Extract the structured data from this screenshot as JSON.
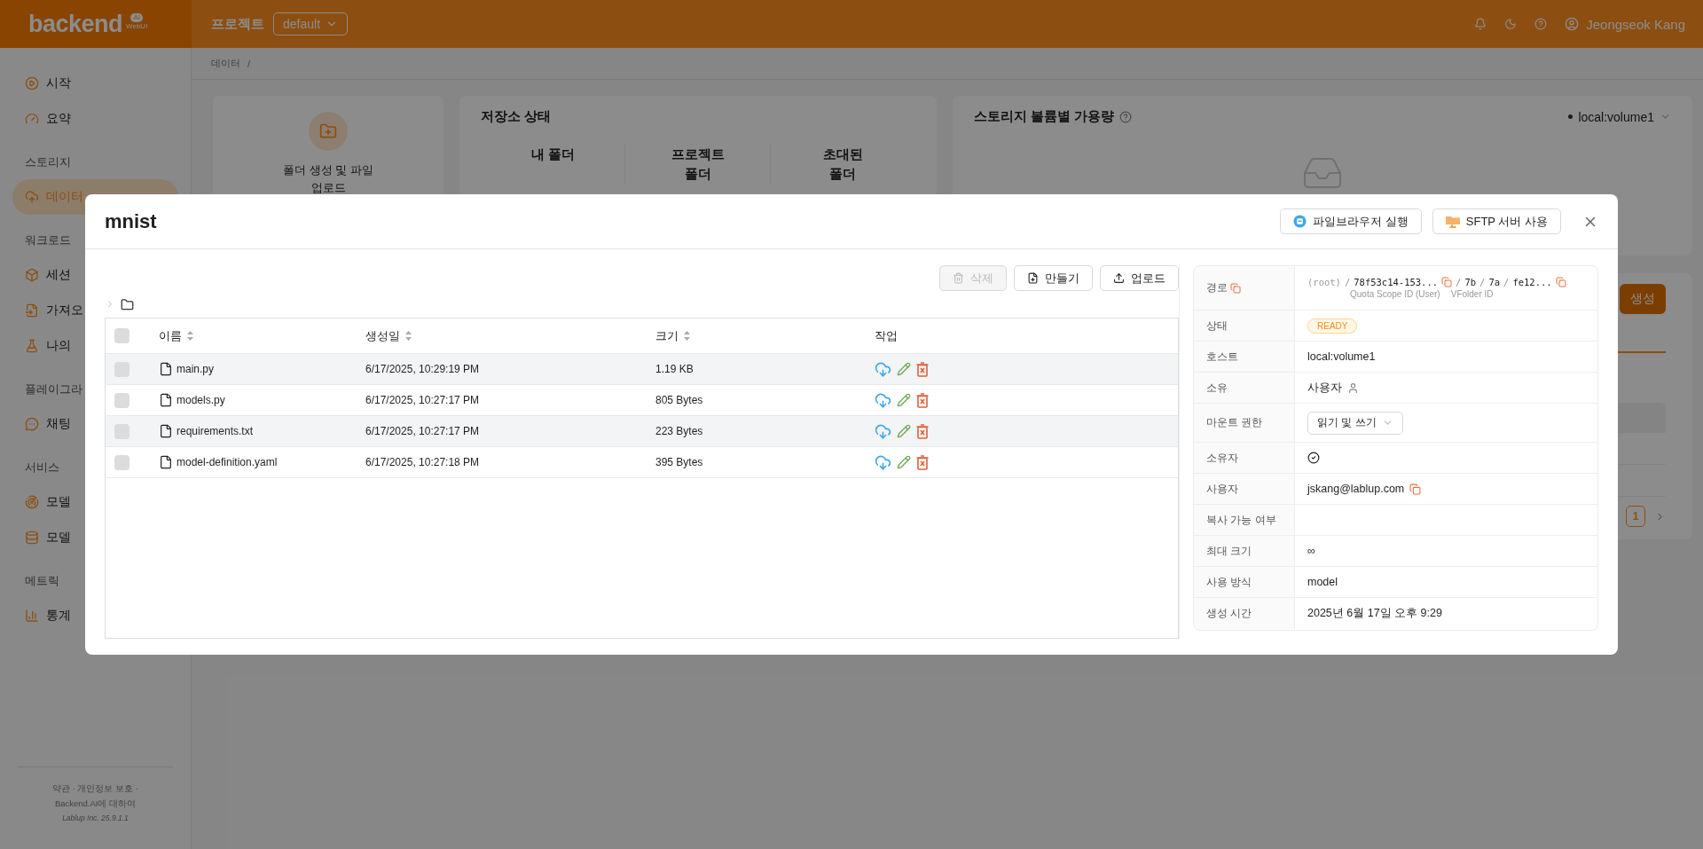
{
  "header": {
    "logo": {
      "word": "backend",
      "badge": "AI",
      "sub": "WebUI"
    },
    "project_label": "프로젝트",
    "project": "default",
    "user": "Jeongseok Kang"
  },
  "breadcrumb": {
    "current": "데이터",
    "separator": "/"
  },
  "sidebar": {
    "items": [
      {
        "kind": "item",
        "label": "시작",
        "selected": false
      },
      {
        "kind": "item",
        "label": "요약",
        "selected": false
      },
      {
        "kind": "section",
        "label": "스토리지"
      },
      {
        "kind": "item",
        "label": "데이터",
        "selected": true
      },
      {
        "kind": "section",
        "label": "워크로드"
      },
      {
        "kind": "item",
        "label": "세션",
        "selected": false
      },
      {
        "kind": "item",
        "label": "가져오",
        "selected": false
      },
      {
        "kind": "item",
        "label": "나의",
        "selected": false
      },
      {
        "kind": "section",
        "label": "플레이그라"
      },
      {
        "kind": "item",
        "label": "채팅",
        "selected": false
      },
      {
        "kind": "section",
        "label": "서비스"
      },
      {
        "kind": "item",
        "label": "모델",
        "selected": false
      },
      {
        "kind": "item",
        "label": "모델",
        "selected": false
      },
      {
        "kind": "section",
        "label": "메트릭"
      },
      {
        "kind": "item",
        "label": "통계",
        "selected": false
      }
    ],
    "footer": {
      "links": "약관 · 개인정보 보호 ·",
      "about": "Backend.AI에 대하여",
      "company": "Lablup Inc.",
      "version": "25.9.1.1"
    }
  },
  "summary_cards": {
    "create": {
      "label": "폴더 생성 및 파일 업로드"
    },
    "storage": {
      "title": "저장소 상태",
      "columns": [
        "내 폴더",
        "프로젝트 폴더",
        "초대된 폴더"
      ]
    },
    "volume": {
      "title": "스토리지 볼륨별 가용량",
      "selected_volume": "local:volume1"
    }
  },
  "folder_panel": {
    "button": "생성",
    "pages": [
      {
        "label": "1",
        "selected": true
      }
    ]
  },
  "modal": {
    "title": "mnist",
    "actions": [
      "파일브라우저 실행",
      "SFTP 서버 사용"
    ],
    "toolbar": [
      {
        "label": "삭제",
        "disabled": true
      },
      {
        "label": "만들기",
        "disabled": false
      },
      {
        "label": "업로드",
        "disabled": false
      }
    ],
    "table": {
      "all_checked": false,
      "columns": [
        {
          "label": "이름",
          "sortable": true
        },
        {
          "label": "생성일",
          "sortable": true
        },
        {
          "label": "크기",
          "sortable": true
        },
        {
          "label": "작업",
          "sortable": false
        }
      ],
      "rows": [
        {
          "name": "main.py",
          "created": "6/17/2025, 10:29:19 PM",
          "size": "1.19 KB",
          "checked": false
        },
        {
          "name": "models.py",
          "created": "6/17/2025, 10:27:17 PM",
          "size": "805 Bytes",
          "checked": false
        },
        {
          "name": "requirements.txt",
          "created": "6/17/2025, 10:27:17 PM",
          "size": "223 Bytes",
          "checked": false
        },
        {
          "name": "model-definition.yaml",
          "created": "6/17/2025, 10:27:18 PM",
          "size": "395 Bytes",
          "checked": false
        }
      ]
    },
    "details": [
      {
        "label": "경로",
        "kind": "path",
        "parts": [
          {
            "kind": "root",
            "text": "(root)"
          },
          {
            "kind": "separator",
            "text": "/"
          },
          {
            "kind": "id",
            "text": "78f53c14-153..."
          },
          {
            "kind": "copy"
          },
          {
            "kind": "separator",
            "text": "/"
          },
          {
            "kind": "id",
            "text": "7b"
          },
          {
            "kind": "separator",
            "text": "/"
          },
          {
            "kind": "id",
            "text": "7a"
          },
          {
            "kind": "separator",
            "text": "/"
          },
          {
            "kind": "id",
            "text": "fe12..."
          },
          {
            "kind": "copy"
          }
        ],
        "captions": [
          "Quota Scope ID (User)",
          "VFolder ID"
        ]
      },
      {
        "label": "상태",
        "kind": "status",
        "value": "READY"
      },
      {
        "label": "호스트",
        "kind": "text",
        "value": "local:volume1"
      },
      {
        "label": "소유",
        "kind": "owner",
        "value": "사용자"
      },
      {
        "label": "마운트 권한",
        "kind": "select",
        "value": "읽기 및 쓰기"
      },
      {
        "label": "소유자",
        "kind": "flag",
        "on": true
      },
      {
        "label": "사용자",
        "kind": "copy",
        "value": "jskang@lablup.com"
      },
      {
        "label": "복사 가능 여부",
        "kind": "flag",
        "on": false
      },
      {
        "label": "최대 크기",
        "kind": "text",
        "value": "∞"
      },
      {
        "label": "사용 방식",
        "kind": "text",
        "value": "model"
      },
      {
        "label": "생성 시간",
        "kind": "text",
        "value": "2025년 6월 17일 오후 9:29"
      }
    ]
  }
}
